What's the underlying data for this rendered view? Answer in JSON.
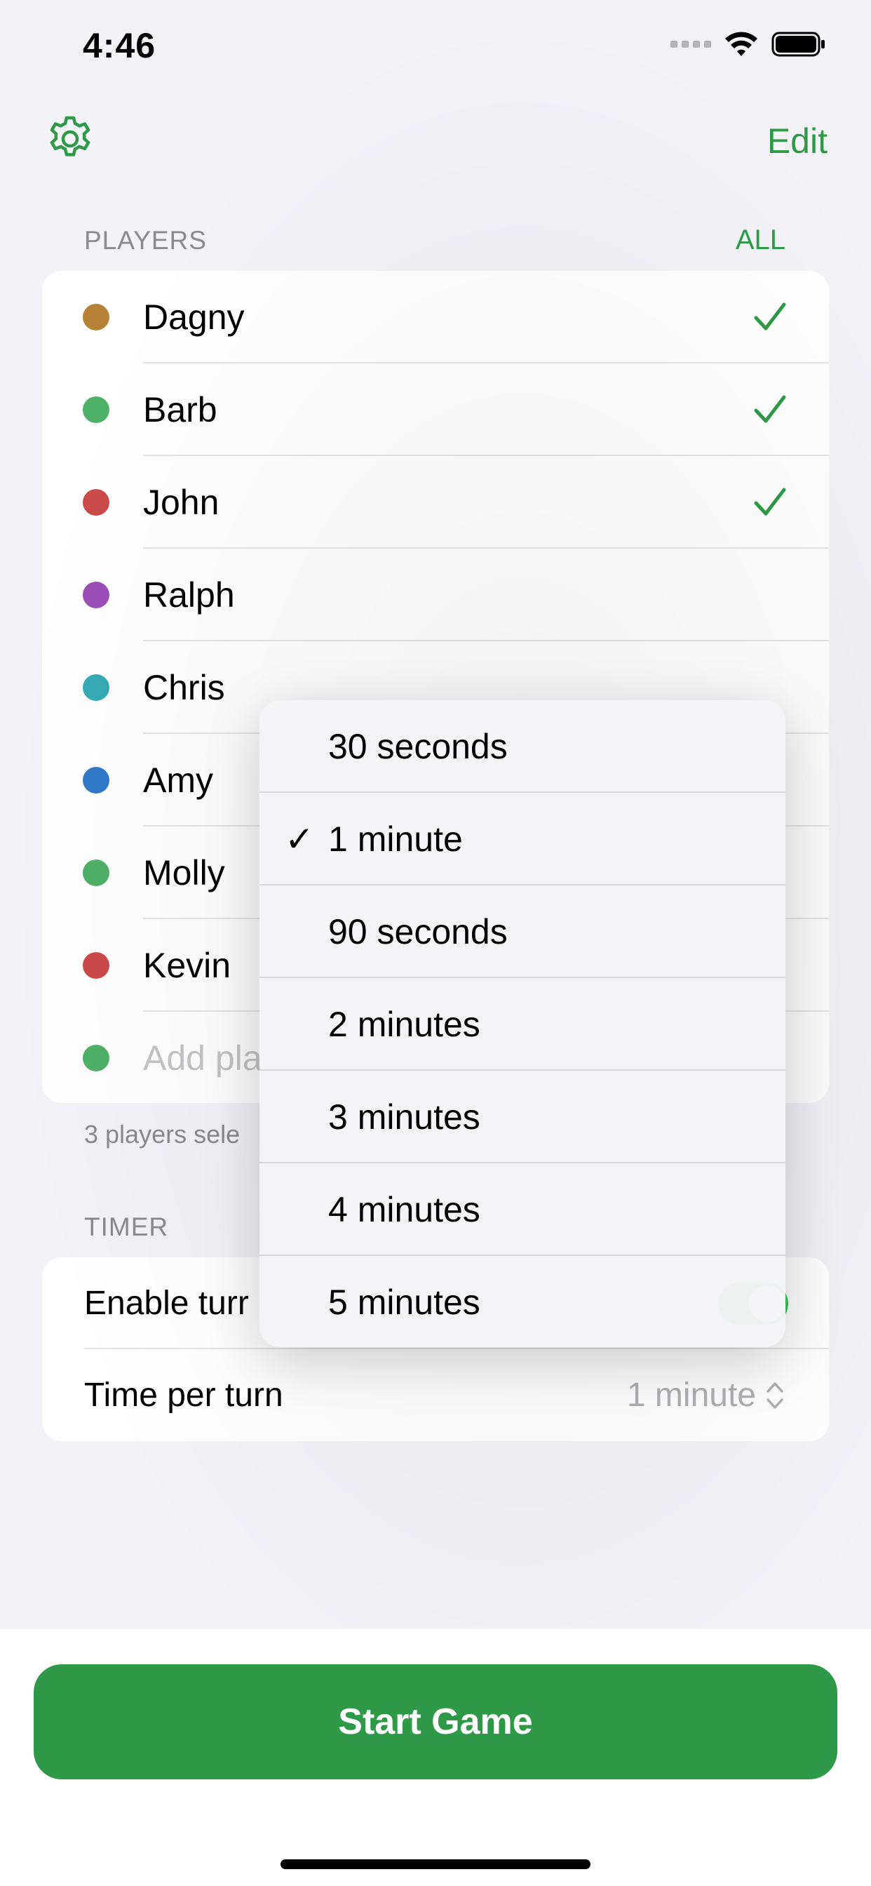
{
  "status": {
    "time": "4:46"
  },
  "nav": {
    "edit_label": "Edit",
    "gear_icon": "gear-icon"
  },
  "players_section": {
    "header": "PLAYERS",
    "all_label": "ALL",
    "players": [
      {
        "name": "Dagny",
        "color": "#b68236",
        "selected": true
      },
      {
        "name": "Barb",
        "color": "#4fb068",
        "selected": true
      },
      {
        "name": "John",
        "color": "#cc4a4a",
        "selected": true
      },
      {
        "name": "Ralph",
        "color": "#9b4fb8",
        "selected": false
      },
      {
        "name": "Chris",
        "color": "#35aab4",
        "selected": false
      },
      {
        "name": "Amy",
        "color": "#3179c9",
        "selected": false
      },
      {
        "name": "Molly",
        "color": "#4fb068",
        "selected": false
      },
      {
        "name": "Kevin",
        "color": "#cc4a4a",
        "selected": false
      }
    ],
    "add_placeholder": "Add pla",
    "add_color": "#4fb068",
    "footer": "3 players sele"
  },
  "timer_section": {
    "header": "TIMER",
    "enable_label": "Enable turr",
    "enable_on": true,
    "time_per_turn_label": "Time per turn",
    "time_per_turn_value": "1 minute"
  },
  "dropdown": {
    "options": [
      "30 seconds",
      "1 minute",
      "90 seconds",
      "2 minutes",
      "3 minutes",
      "4 minutes",
      "5 minutes"
    ],
    "selected_index": 1,
    "check_glyph": "✓"
  },
  "start_button": {
    "label": "Start Game"
  },
  "colors": {
    "accent": "#2e9a48",
    "background": "#f2f2f7"
  }
}
